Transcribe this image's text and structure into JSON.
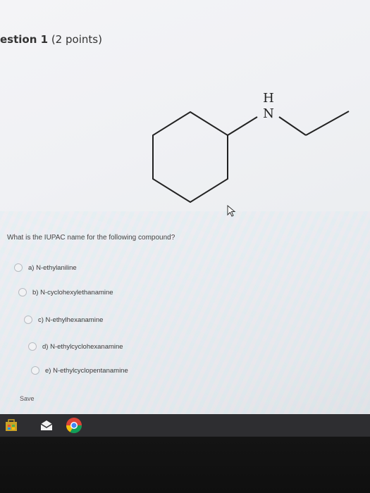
{
  "question": {
    "title_main": "estion 1",
    "title_points": " (2 points)",
    "prompt": "What is the IUPAC name for the following compound?"
  },
  "molecule": {
    "atom_h": "H",
    "atom_n": "N"
  },
  "choices": [
    {
      "label": "a)  N-ethylaniline"
    },
    {
      "label": "b)  N-cyclohexylethanamine"
    },
    {
      "label": "c)  N-ethylhexanamine"
    },
    {
      "label": "d)  N-ethylcyclohexanamine"
    },
    {
      "label": "e)  N-ethylcyclopentanamine"
    }
  ],
  "actions": {
    "save_label": "Save"
  },
  "taskbar": {
    "icons": [
      "store-icon",
      "mail-icon",
      "chrome-icon"
    ]
  }
}
